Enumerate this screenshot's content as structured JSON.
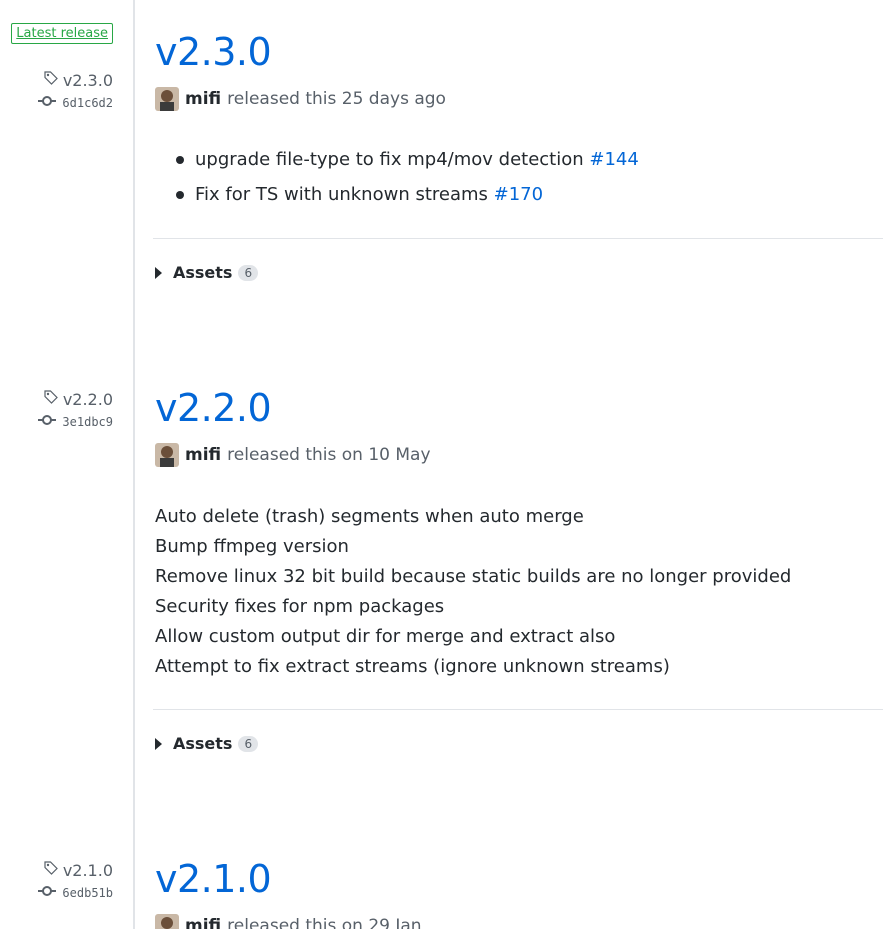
{
  "latest_badge": "Latest release",
  "releases": [
    {
      "tag": "v2.3.0",
      "commit": "6d1c6d2",
      "title": "v2.3.0",
      "author": "mifi",
      "released_text": "released this 25 days ago",
      "bullets": [
        {
          "text": "upgrade file-type to fix mp4/mov detection ",
          "link": "#144"
        },
        {
          "text": "Fix for TS with unknown streams ",
          "link": "#170"
        }
      ],
      "assets_label": "Assets",
      "assets_count": "6"
    },
    {
      "tag": "v2.2.0",
      "commit": "3e1dbc9",
      "title": "v2.2.0",
      "author": "mifi",
      "released_text": "released this on 10 May",
      "notes": [
        "Auto delete (trash) segments when auto merge",
        "Bump ffmpeg version",
        "Remove linux 32 bit build because static builds are no longer provided",
        "Security fixes for npm packages",
        "Allow custom output dir for merge and extract also",
        "Attempt to fix extract streams (ignore unknown streams)"
      ],
      "assets_label": "Assets",
      "assets_count": "6"
    },
    {
      "tag": "v2.1.0",
      "commit": "6edb51b",
      "title": "v2.1.0",
      "author": "mifi",
      "released_text": "released this on 29 Jan"
    }
  ],
  "icons": {
    "tag": "tag-icon",
    "commit": "git-commit-icon",
    "caret": "triangle-right-icon"
  },
  "colors": {
    "link": "#0366d6",
    "latest": "#28a745",
    "muted": "#586069",
    "border": "#e1e4e8"
  }
}
